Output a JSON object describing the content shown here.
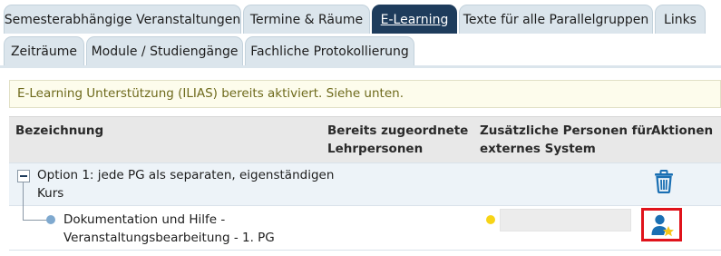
{
  "tabs": [
    {
      "label": "Semesterabhängige Veranstaltungen",
      "active": false
    },
    {
      "label": "Termine & Räume",
      "active": false
    },
    {
      "label": "E-Learning",
      "active": true
    },
    {
      "label": "Texte für alle Parallelgruppen",
      "active": false
    },
    {
      "label": "Links",
      "active": false
    },
    {
      "label": "Zeiträume",
      "active": false
    },
    {
      "label": "Module / Studiengänge",
      "active": false
    },
    {
      "label": "Fachliche Protokollierung",
      "active": false
    }
  ],
  "notice": "E-Learning Unterstützung (ILIAS) bereits aktiviert. Siehe unten.",
  "table": {
    "headers": {
      "bezeichnung": "Bezeichnung",
      "lehrpersonen": [
        "Bereits zugeordnete",
        "Lehrpersonen"
      ],
      "zusaetzlich": [
        "Zusätzliche Personen für",
        "externes System"
      ],
      "aktionen": "Aktionen"
    },
    "rows": [
      {
        "label": [
          "Option 1: jede PG als separaten, eigenständigen",
          "Kurs"
        ],
        "action_icon": "trash-icon"
      },
      {
        "label": [
          "Dokumentation und Hilfe -",
          "Veranstaltungsbearbeitung - 1. PG"
        ],
        "action_icon": "user-star-icon"
      }
    ]
  },
  "colors": {
    "active_tab": "#1e3c5c",
    "tab": "#dbe5ec",
    "icon_blue": "#1a6fb3",
    "highlight_red": "#e0131b",
    "status_yellow": "#f7d417"
  }
}
